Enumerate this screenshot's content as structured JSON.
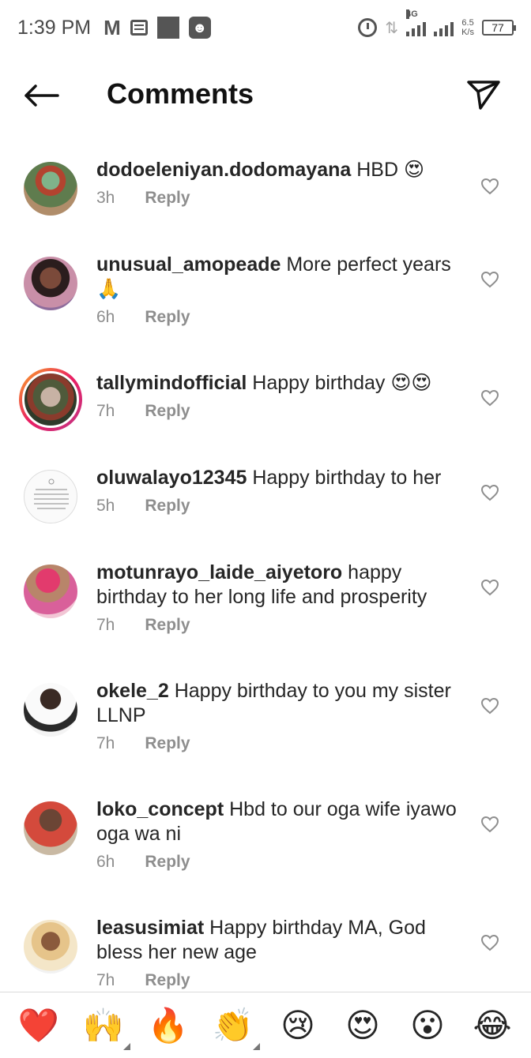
{
  "status_bar": {
    "time": "1:39 PM",
    "network": "4G",
    "speed_value": "6.5",
    "speed_unit": "K/s",
    "battery": "77"
  },
  "header": {
    "title": "Comments"
  },
  "reply_label": "Reply",
  "comments": [
    {
      "username": "dodoeleniyan.dodomayana",
      "text": "HBD 😍",
      "time": "3h"
    },
    {
      "username": "unusual_amopeade",
      "text": "More perfect years 🙏",
      "time": "6h"
    },
    {
      "username": "tallymindofficial",
      "text": "Happy birthday 😍😍",
      "time": "7h"
    },
    {
      "username": "oluwalayo12345",
      "text": "Happy birthday to her",
      "time": "5h"
    },
    {
      "username": "motunrayo_laide_aiyetoro",
      "text": "happy birthday to her long life and prosperity",
      "time": "7h"
    },
    {
      "username": "okele_2",
      "text": "Happy birthday to you my sister LLNP",
      "time": "7h"
    },
    {
      "username": "loko_concept",
      "text": "Hbd to our oga wife iyawo  oga wa ni",
      "time": "6h"
    },
    {
      "username": "leasusimiat",
      "text": "Happy birthday MA, God bless her new age",
      "time": "7h"
    }
  ],
  "emoji_bar": [
    {
      "emoji": "❤️",
      "name": "red-heart"
    },
    {
      "emoji": "🙌",
      "name": "raising-hands"
    },
    {
      "emoji": "🔥",
      "name": "fire"
    },
    {
      "emoji": "👏",
      "name": "clapping-hands"
    },
    {
      "emoji": "😢",
      "name": "crying-face"
    },
    {
      "emoji": "😍",
      "name": "heart-eyes"
    },
    {
      "emoji": "😮",
      "name": "surprised-face"
    },
    {
      "emoji": "😂",
      "name": "joy-face"
    }
  ]
}
